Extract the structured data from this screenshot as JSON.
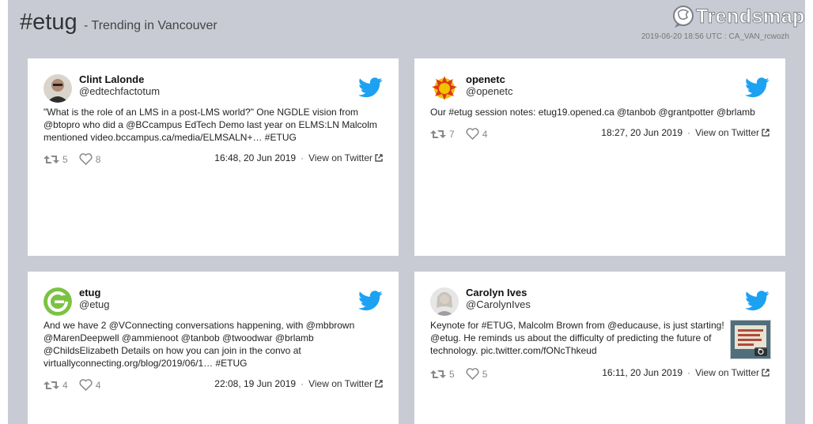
{
  "header": {
    "hashtag": "#etug",
    "subtitle": "- Trending in Vancouver",
    "logo_text": "Trendsmap",
    "timestamp": "2019-06-20 18:56 UTC : CA_VAN_rcwozh"
  },
  "colors": {
    "twitter_blue": "#1da1f2",
    "frame_bg": "#c8cbd3"
  },
  "tweets": [
    {
      "name": "Clint Lalonde",
      "handle": "@edtechfactotum",
      "text": "\"What is the role of an LMS in a post-LMS world?\" One NGDLE vision from @btopro who did a @BCcampus EdTech Demo last year on ELMS:LN Malcolm mentioned video.bccampus.ca/media/ELMSALN+… #ETUG",
      "retweets": "5",
      "likes": "8",
      "time": "16:48, 20 Jun 2019",
      "view_label": "View on Twitter"
    },
    {
      "name": "openetc",
      "handle": "@openetc",
      "text": "Our #etug session notes: etug19.opened.ca @tanbob @grantpotter @brlamb",
      "retweets": "7",
      "likes": "4",
      "time": "18:27, 20 Jun 2019",
      "view_label": "View on Twitter"
    },
    {
      "name": "etug",
      "handle": "@etug",
      "text": "And we have 2 @VConnecting conversations happening, with @mbbrown @MarenDeepwell @ammienoot @tanbob @twoodwar @brlamb @ChildsElizabeth Details on how you can join in the convo at virtuallyconnecting.org/blog/2019/06/1… #ETUG",
      "retweets": "4",
      "likes": "4",
      "time": "22:08, 19 Jun 2019",
      "view_label": "View on Twitter"
    },
    {
      "name": "Carolyn Ives",
      "handle": "@CarolynIves",
      "text": "Keynote for #ETUG, Malcolm Brown from @educause, is just starting! @etug. He reminds us about the difficulty of predicting the future of technology. pic.twitter.com/fONcThkeud",
      "retweets": "5",
      "likes": "5",
      "time": "16:11, 20 Jun 2019",
      "view_label": "View on Twitter"
    }
  ]
}
